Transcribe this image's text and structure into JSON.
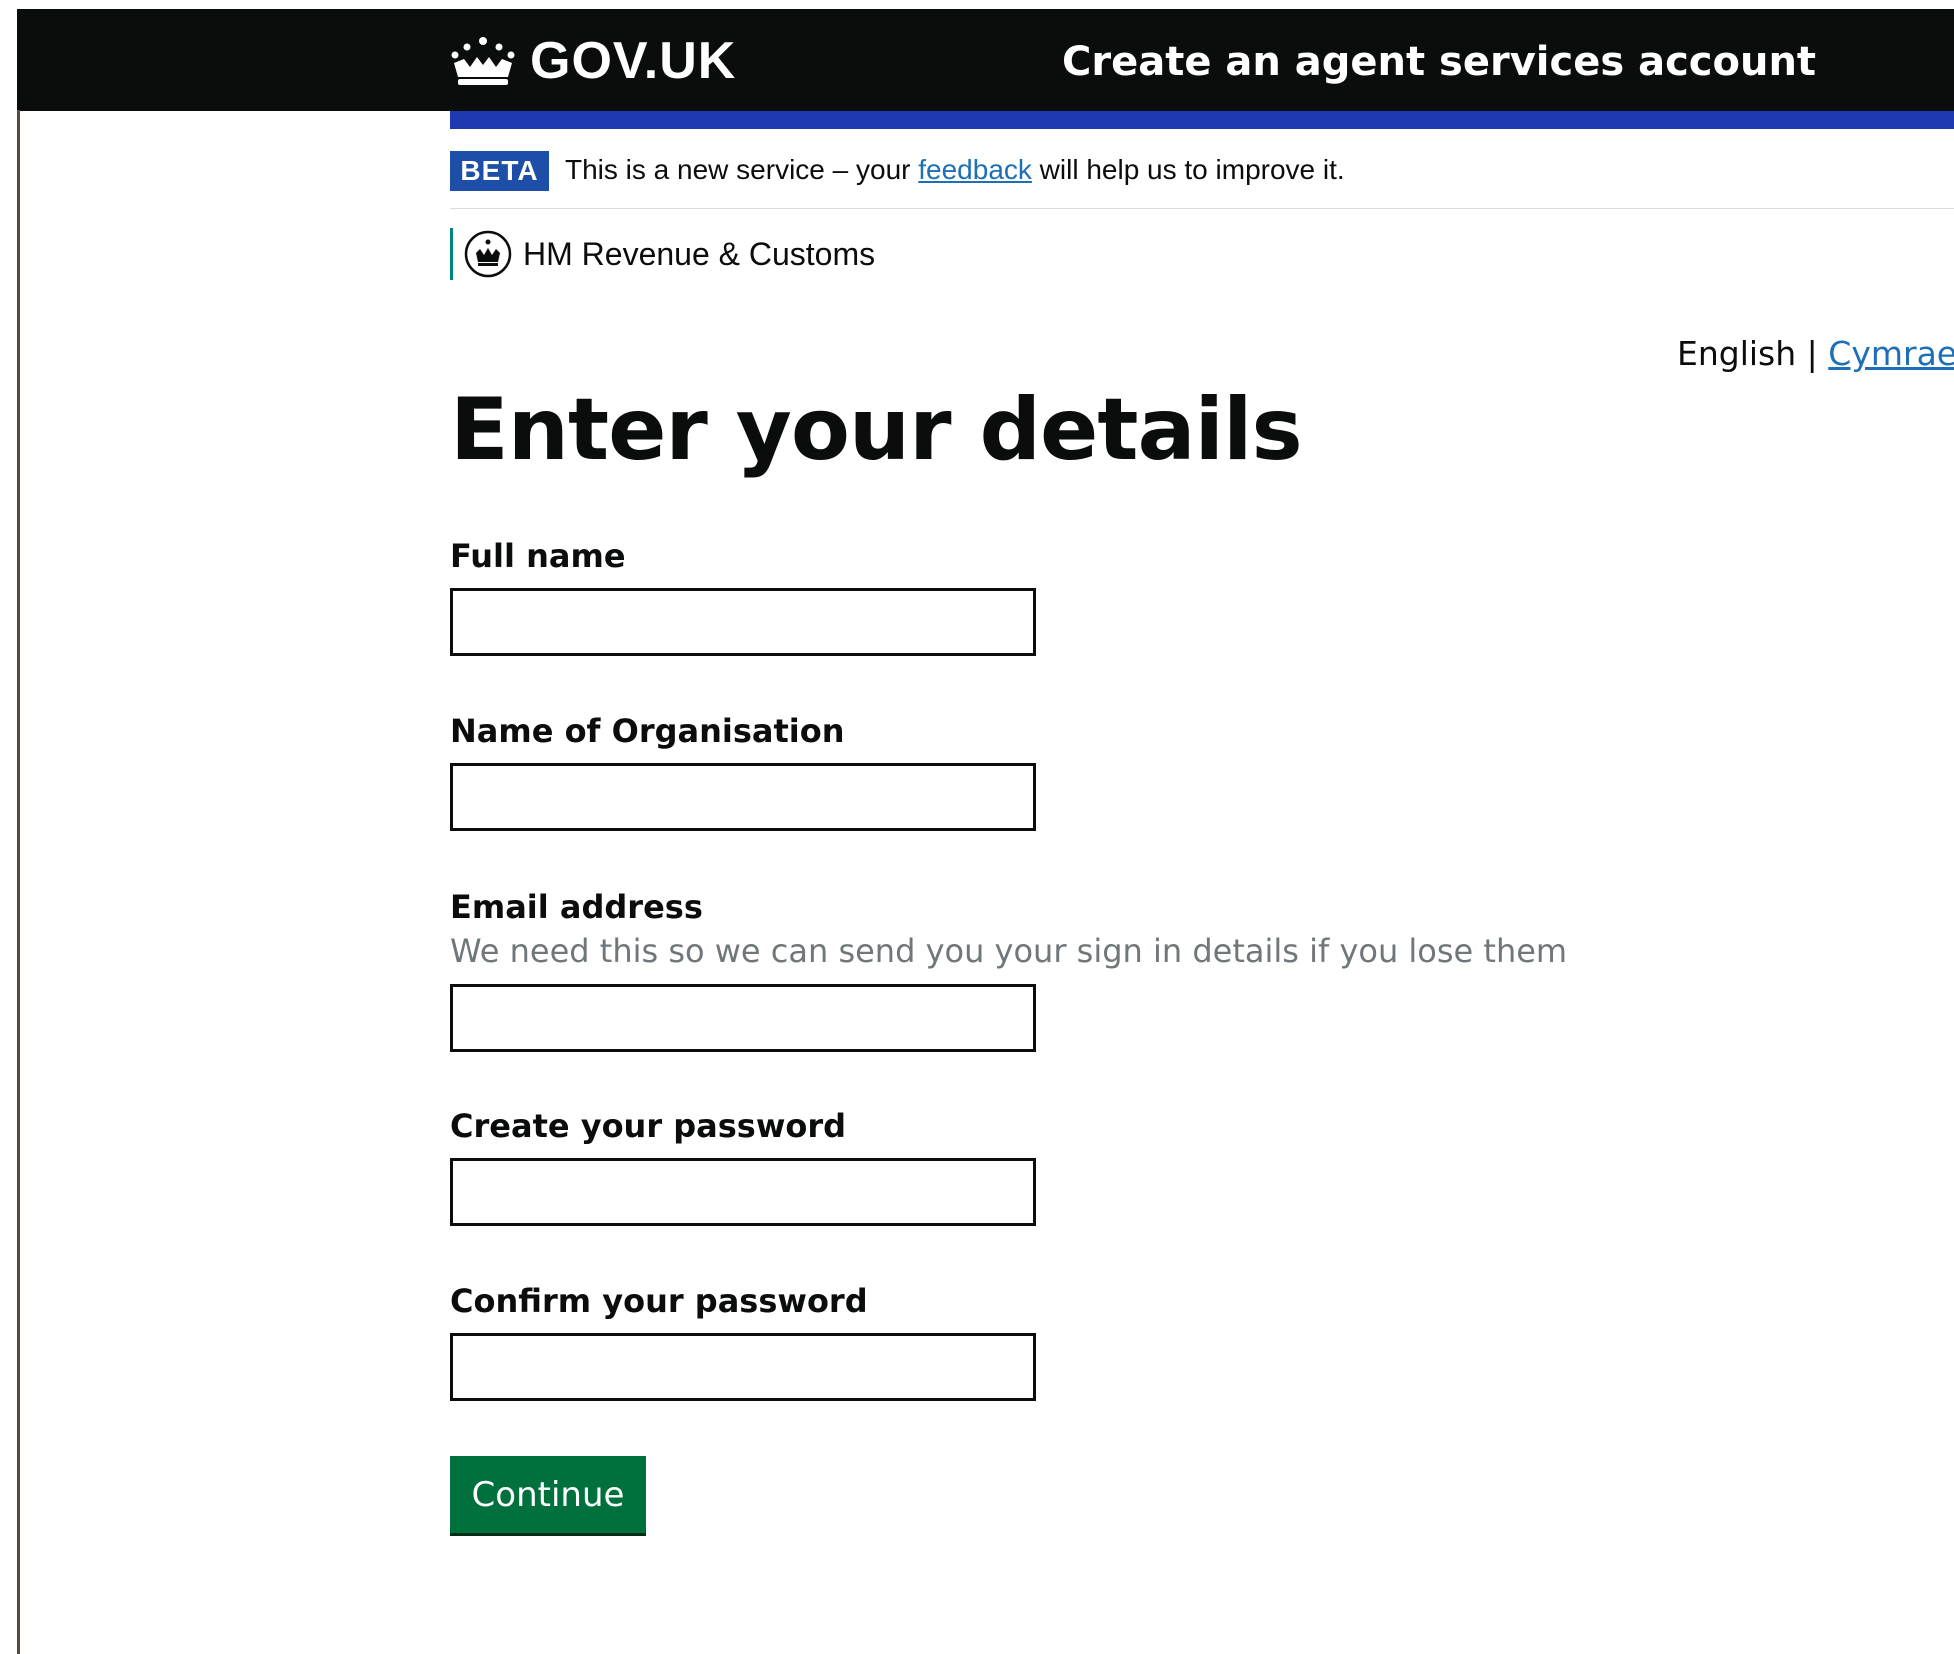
{
  "header": {
    "logo_text": "GOV.UK",
    "service_name": "Create an agent services account"
  },
  "beta": {
    "tag": "BETA",
    "text_before": "This is a new service – your ",
    "feedback_link": "feedback",
    "text_after": " will help us to improve it."
  },
  "organisation": {
    "name": "HM Revenue & Customs"
  },
  "language": {
    "current": "English",
    "separator": " | ",
    "alternate": "Cymraeg"
  },
  "main": {
    "title": "Enter your details",
    "fields": [
      {
        "label": "Full name",
        "value": ""
      },
      {
        "label": "Name of Organisation",
        "value": ""
      },
      {
        "label": "Email address",
        "hint": "We need this so we can send you your sign in details if you lose them",
        "value": ""
      },
      {
        "label": "Create your password",
        "value": ""
      },
      {
        "label": "Confirm your password",
        "value": ""
      }
    ],
    "continue_label": "Continue"
  },
  "colors": {
    "header_bg": "#0b0c0c",
    "blue_bar": "#1d3ab0",
    "beta_tag": "#1d4fa8",
    "link": "#1d70b8",
    "button": "#00703c",
    "hmrc_rule": "#00857f"
  },
  "icons": {
    "logo": "crown-icon",
    "hmrc": "hmrc-crest-icon"
  }
}
